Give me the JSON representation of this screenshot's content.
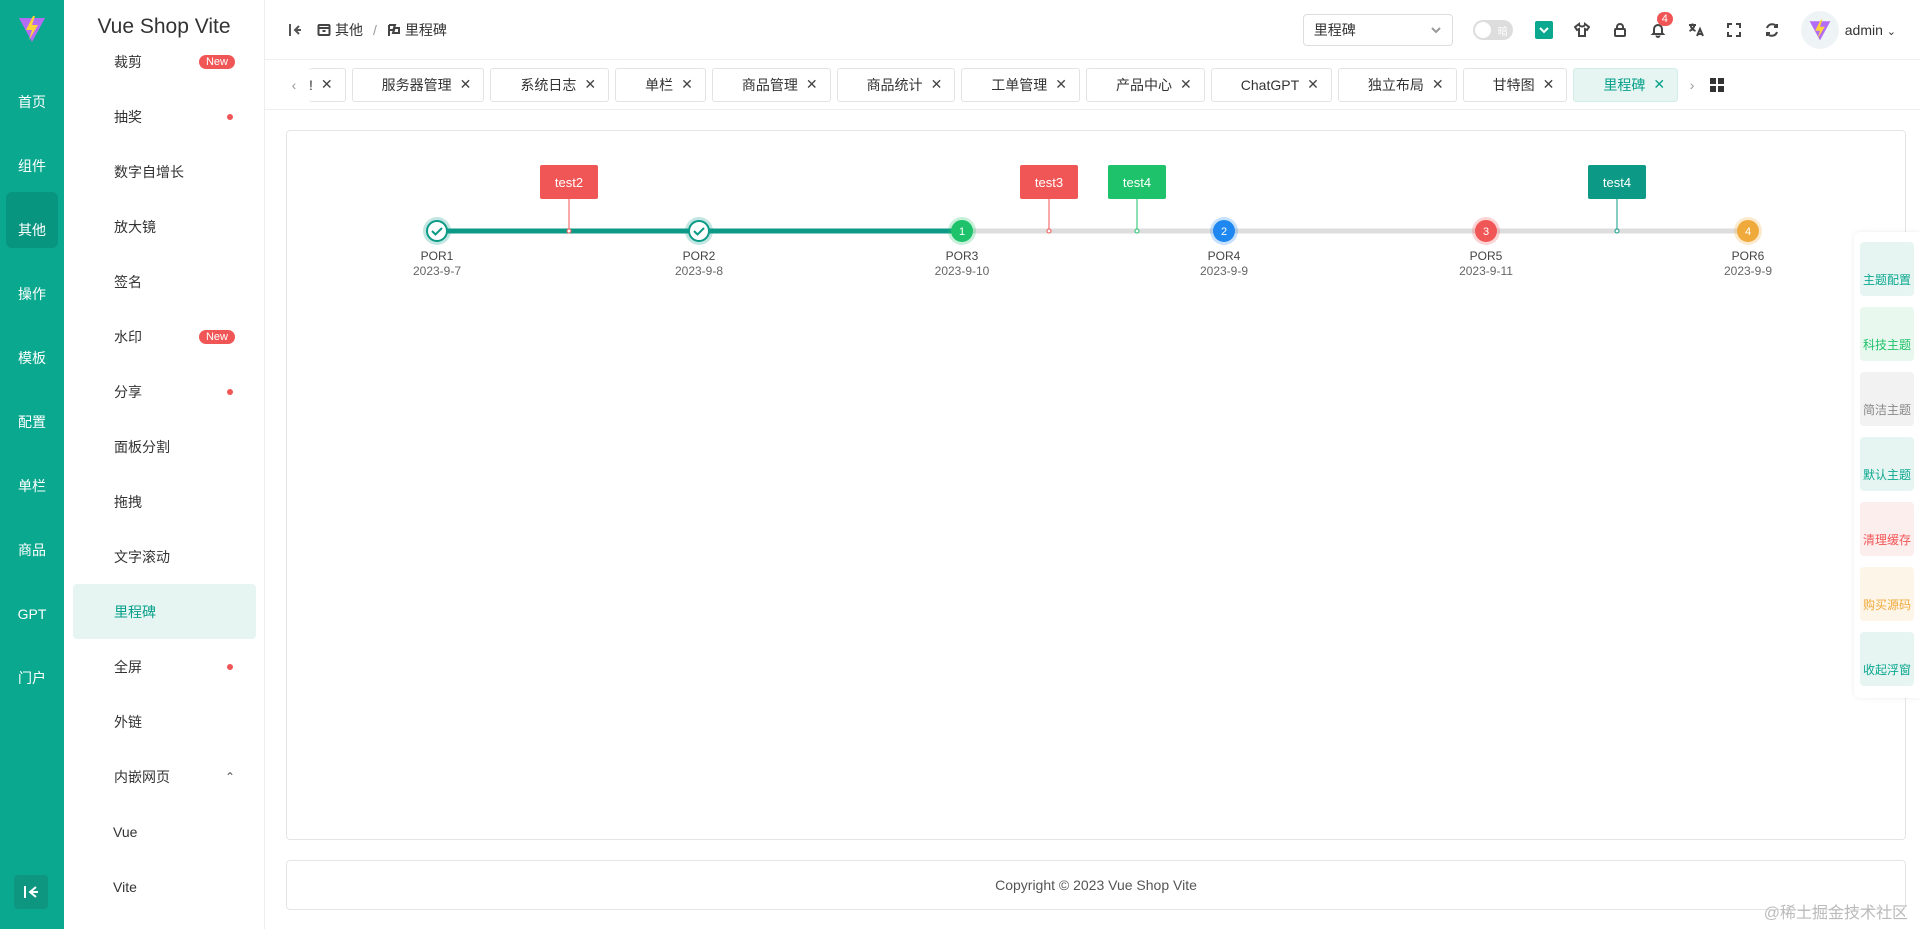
{
  "app": {
    "brand": "Vue Shop Vite"
  },
  "rail": {
    "items": [
      {
        "label": "首页",
        "icon": "home-icon"
      },
      {
        "label": "组件",
        "icon": "chart-icon"
      },
      {
        "label": "其他",
        "icon": "box-icon",
        "active": true
      },
      {
        "label": "操作",
        "icon": "user-gear-icon"
      },
      {
        "label": "模板",
        "icon": "clipboard-icon"
      },
      {
        "label": "配置",
        "icon": "user-icon"
      },
      {
        "label": "单栏",
        "icon": "column-icon"
      },
      {
        "label": "商品",
        "icon": "shop-icon"
      },
      {
        "label": "GPT",
        "icon": "chat-icon"
      },
      {
        "label": "门户",
        "icon": "portal-icon"
      }
    ]
  },
  "submenu": {
    "items": [
      {
        "label": "裁剪",
        "badge": "New"
      },
      {
        "label": "抽奖",
        "dot": true
      },
      {
        "label": "数字自增长"
      },
      {
        "label": "放大镜"
      },
      {
        "label": "签名"
      },
      {
        "label": "水印",
        "badge": "New"
      },
      {
        "label": "分享",
        "dot": true
      },
      {
        "label": "面板分割"
      },
      {
        "label": "拖拽"
      },
      {
        "label": "文字滚动"
      },
      {
        "label": "里程碑",
        "active": true
      },
      {
        "label": "全屏",
        "dot": true
      },
      {
        "label": "外链"
      },
      {
        "label": "内嵌网页",
        "expanded": true
      }
    ],
    "children": [
      "Vue",
      "Vite"
    ]
  },
  "header": {
    "breadcrumb": [
      "其他",
      "里程碑"
    ],
    "select_value": "里程碑",
    "switch_label": "暗",
    "notification_count": "4",
    "user": "admin"
  },
  "tabs": [
    {
      "label": "!"
    },
    {
      "label": "服务器管理"
    },
    {
      "label": "系统日志"
    },
    {
      "label": "单栏"
    },
    {
      "label": "商品管理"
    },
    {
      "label": "商品统计"
    },
    {
      "label": "工单管理"
    },
    {
      "label": "产品中心"
    },
    {
      "label": "ChatGPT"
    },
    {
      "label": "独立布局"
    },
    {
      "label": "甘特图"
    },
    {
      "label": "里程碑",
      "active": true
    }
  ],
  "milestones": {
    "points": [
      {
        "name": "POR1",
        "date": "2023-9-7",
        "mark": "check",
        "color": "#0c9a86"
      },
      {
        "name": "POR2",
        "date": "2023-9-8",
        "mark": "check",
        "color": "#0c9a86"
      },
      {
        "name": "POR3",
        "date": "2023-9-10",
        "mark": "1",
        "color": "#1ec26a"
      },
      {
        "name": "POR4",
        "date": "2023-9-9",
        "mark": "2",
        "color": "#1e88f0"
      },
      {
        "name": "POR5",
        "date": "2023-9-11",
        "mark": "3",
        "color": "#f15656"
      },
      {
        "name": "POR6",
        "date": "2023-9-9",
        "mark": "4",
        "color": "#f0aa3c"
      }
    ],
    "flags": [
      {
        "label": "test2",
        "color": "#f15656"
      },
      {
        "label": "test3",
        "color": "#f15656"
      },
      {
        "label": "test4",
        "color": "#1ec26a"
      },
      {
        "label": "test4",
        "color": "#0c9a86"
      }
    ]
  },
  "float_panel": [
    {
      "label": "主题配置",
      "icon": "shirt-icon",
      "color": "#0aa88f",
      "bg": "#e6f5f2"
    },
    {
      "label": "科技主题",
      "icon": "bulb-icon",
      "color": "#1ec26a",
      "bg": "#e8f8ee"
    },
    {
      "label": "简洁主题",
      "icon": "monitor-icon",
      "color": "#888888",
      "bg": "#f2f2f2"
    },
    {
      "label": "默认主题",
      "icon": "undo-icon",
      "color": "#0aa88f",
      "bg": "#e6f5f2"
    },
    {
      "label": "清理缓存",
      "icon": "trash-icon",
      "color": "#f15656",
      "bg": "#fdeeee"
    },
    {
      "label": "购买源码",
      "icon": "cart-icon",
      "color": "#f0aa3c",
      "bg": "#fdf5e8"
    },
    {
      "label": "收起浮窗",
      "icon": "double-up-icon",
      "color": "#0aa88f",
      "bg": "#e6f5f2"
    }
  ],
  "footer": {
    "text": "Copyright © 2023 Vue Shop Vite"
  },
  "watermark": "@稀土掘金技术社区"
}
